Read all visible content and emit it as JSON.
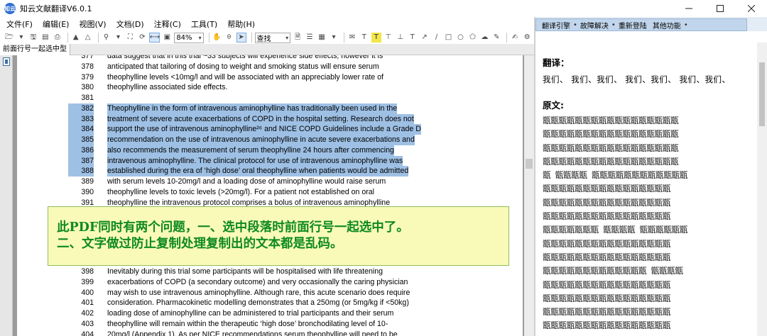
{
  "window": {
    "title": "知云文献翻译V6.0.1",
    "app_icon_text": "知云"
  },
  "menu": [
    "文件(F)",
    "编辑(E)",
    "视图(V)",
    "文档(D)",
    "注释(C)",
    "工具(T)",
    "帮助(H)"
  ],
  "toolbar": {
    "zoom": "84%",
    "search": "查找"
  },
  "tab": {
    "label": "前面行号一起选中型"
  },
  "document": {
    "lines": [
      {
        "num": "377",
        "text": "data suggest that in this trial ~33 subjects will experience side effects, however it is",
        "selected": false
      },
      {
        "num": "378",
        "text": "anticipated that tailoring of dosing to weight and smoking status will ensure serum",
        "selected": false
      },
      {
        "num": "379",
        "text": "theophylline levels <10mg/l and will be associated with an appreciably lower rate of",
        "selected": false
      },
      {
        "num": "380",
        "text": "theophylline associated side effects.",
        "selected": false
      },
      {
        "num": "381",
        "text": "",
        "selected": false
      },
      {
        "num": "382",
        "text": "Theophylline in the form of intravenous aminophylline has traditionally been used in the",
        "selected": true
      },
      {
        "num": "383",
        "text": "treatment of severe acute exacerbations of COPD in the hospital setting.  Research does not",
        "selected": true
      },
      {
        "num": "384",
        "text": "support the use of intravenous aminophylline²⁶ and NICE COPD Guidelines include a Grade D",
        "selected": true
      },
      {
        "num": "385",
        "text": "recommendation on the use of intravenous aminophylline in acute severe exacerbations and",
        "selected": true
      },
      {
        "num": "386",
        "text": "also recommends the measurement of serum theophylline 24 hours after commencing",
        "selected": true
      },
      {
        "num": "387",
        "text": "intravenous aminophylline.  The clinical protocol for use of intravenous aminophylline was",
        "selected": true
      },
      {
        "num": "388",
        "text": "established during the era of ‘high dose’ oral theophylline when patients would be admitted",
        "selected": true
      },
      {
        "num": "389",
        "text": "with serum levels 10-20mg/l and a loading dose of aminophylline would raise serum",
        "selected": false
      },
      {
        "num": "390",
        "text": "theophylline levels to toxic levels (>20mg/l).  For a patient not established on oral",
        "selected": false
      },
      {
        "num": "391",
        "text": "theophylline the intravenous protocol comprises a bolus of intravenous aminophylline",
        "selected": false
      }
    ],
    "lines_lower": [
      {
        "num": "398",
        "text": "Inevitably during this trial some participants will be hospitalised with life threatening",
        "selected": false
      },
      {
        "num": "399",
        "text": "exacerbations of COPD (a secondary outcome) and very occasionally the caring physician",
        "selected": false
      },
      {
        "num": "400",
        "text": "may wish to use intravenous aminophylline.  Although rare, this acute scenario does require",
        "selected": false
      },
      {
        "num": "401",
        "text": "consideration.  Pharmacokinetic modelling demonstrates that a 250mg (or 5mg/kg if <50kg)",
        "selected": false
      },
      {
        "num": "402",
        "text": "loading dose of aminophylline can be administered to trial participants and their serum",
        "selected": false
      },
      {
        "num": "403",
        "text": "theophylline will remain within the therapeutic ‘high dose’ bronchodilating level of 10-",
        "selected": false
      },
      {
        "num": "404",
        "text": "20mg/l (Appendix 1).  As per NICE recommendations serum theophylline will need to be",
        "selected": false
      }
    ]
  },
  "annotation": {
    "line1": "此PDF同时有两个问题，一、选中段落时前面行号一起选中了。",
    "line2": "二、文字做过防止复制处理复制出的文本都是乱码。"
  },
  "right_panel": {
    "links": [
      "翻译引擎",
      "故障解决",
      "重新登陆",
      "其他功能"
    ],
    "translation_heading": "翻译：",
    "translation_text": "我们、 我们、我们、 我们、我们、 我们、我们、",
    "original_heading": "原文:",
    "original_lines": [
      "甑甑甑甑甑甑甑甑甑甑甑甑甑甑甑甑甑",
      "甑甑甑甑甑甑甑甑甑甑甑甑甑甑甑甑甑",
      "甑甑甑甑甑甑甑甑甑甑甑甑甑甑甑甑甑",
      "甑甑甑甑甑甑甑甑甑甑甑甑甑甑甑甑甑",
      "甑  甑甑甑甑  甑甑甑甑甑甑甑甑甑甑甑甑",
      "甑甑甑甑甑甑甑甑甑甑甑甑甑甑甑甑",
      "甑甑甑甑甑甑甑甑甑甑甑甑甑甑甑甑",
      "甑甑甑甑甑甑甑甑甑甑甑甑甑甑甑甑",
      "甑甑甑甑甑甑甑  甑甑甑甑  甑甑甑甑甑甑",
      "甑甑甑甑甑甑甑甑甑甑甑甑甑甑甑甑",
      "甑甑甑甑甑甑甑甑甑甑甑甑甑甑甑甑",
      "甑甑甑甑甑甑甑甑甑甑甑甑甑  甑甑甑甑",
      "甑甑甑甑甑甑甑甑甑甑甑甑甑甑甑甑",
      "甑甑甑甑甑甑甑甑甑甑甑甑甑甑甑甑",
      "甑甑甑甑甑甑甑甑甑甑甑甑甑甑甑甑",
      "甑甑甑甑甑甑甑甑甑甑甑甑甑甑甑甑"
    ]
  }
}
